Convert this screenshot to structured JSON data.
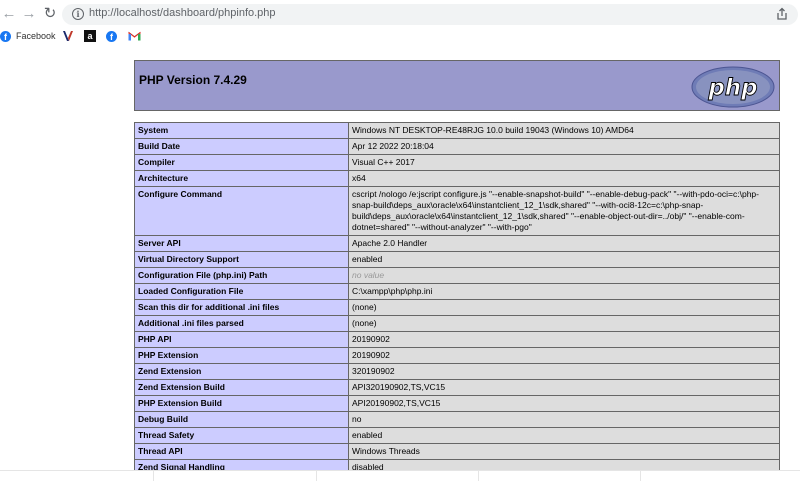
{
  "browser": {
    "url": "http://localhost/dashboard/phpinfo.php",
    "icons": {
      "back": "back-arrow-icon",
      "forward": "forward-arrow-icon",
      "reload": "reload-icon",
      "info": "info-icon",
      "share": "share-icon"
    }
  },
  "bookmarks": [
    {
      "label": "Facebook",
      "icon": "facebook-icon"
    },
    {
      "label": "",
      "icon": "v-logo-icon"
    },
    {
      "label": "",
      "icon": "amazon-icon"
    },
    {
      "label": "",
      "icon": "facebook-icon"
    },
    {
      "label": "",
      "icon": "gmail-icon"
    }
  ],
  "phpinfo": {
    "header_title": "PHP Version 7.4.29",
    "logo_text": "php",
    "colors": {
      "header_bg": "#9999cc",
      "key_bg": "#ccccff",
      "value_bg": "#dddddd"
    },
    "rows": [
      {
        "key": "System",
        "value": "Windows NT DESKTOP-RE48RJG 10.0 build 19043 (Windows 10) AMD64"
      },
      {
        "key": "Build Date",
        "value": "Apr 12 2022 20:18:04"
      },
      {
        "key": "Compiler",
        "value": "Visual C++ 2017"
      },
      {
        "key": "Architecture",
        "value": "x64"
      },
      {
        "key": "Configure Command",
        "value": "cscript /nologo /e:jscript configure.js \"--enable-snapshot-build\" \"--enable-debug-pack\" \"--with-pdo-oci=c:\\php-snap-build\\deps_aux\\oracle\\x64\\instantclient_12_1\\sdk,shared\" \"--with-oci8-12c=c:\\php-snap-build\\deps_aux\\oracle\\x64\\instantclient_12_1\\sdk,shared\" \"--enable-object-out-dir=../obj/\" \"--enable-com-dotnet=shared\" \"--without-analyzer\" \"--with-pgo\""
      },
      {
        "key": "Server API",
        "value": "Apache 2.0 Handler"
      },
      {
        "key": "Virtual Directory Support",
        "value": "enabled"
      },
      {
        "key": "Configuration File (php.ini) Path",
        "value": "no value"
      },
      {
        "key": "Loaded Configuration File",
        "value": "C:\\xampp\\php\\php.ini"
      },
      {
        "key": "Scan this dir for additional .ini files",
        "value": "(none)"
      },
      {
        "key": "Additional .ini files parsed",
        "value": "(none)"
      },
      {
        "key": "PHP API",
        "value": "20190902"
      },
      {
        "key": "PHP Extension",
        "value": "20190902"
      },
      {
        "key": "Zend Extension",
        "value": "320190902"
      },
      {
        "key": "Zend Extension Build",
        "value": "API320190902,TS,VC15"
      },
      {
        "key": "PHP Extension Build",
        "value": "API20190902,TS,VC15"
      },
      {
        "key": "Debug Build",
        "value": "no"
      },
      {
        "key": "Thread Safety",
        "value": "enabled"
      },
      {
        "key": "Thread API",
        "value": "Windows Threads"
      },
      {
        "key": "Zend Signal Handling",
        "value": "disabled"
      }
    ]
  }
}
